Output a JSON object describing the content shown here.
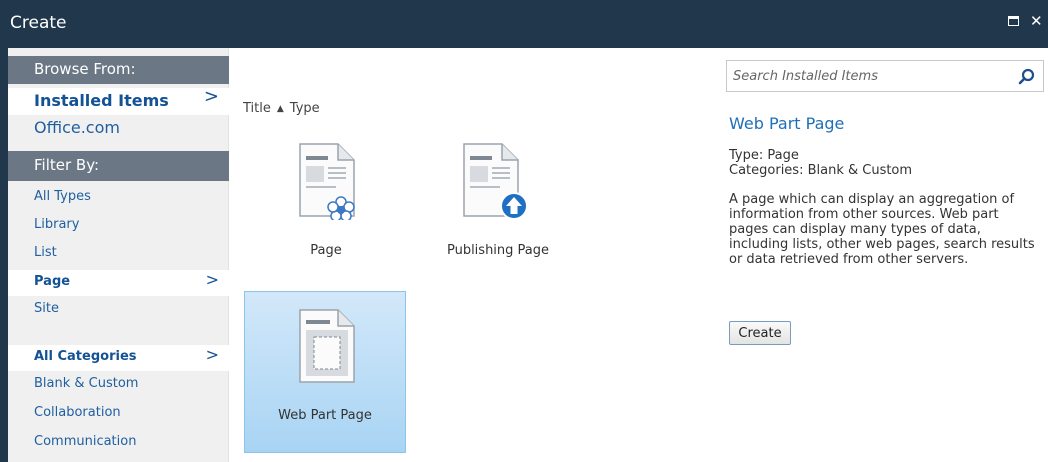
{
  "window": {
    "title": "Create"
  },
  "sidebar": {
    "browse_header": "Browse From:",
    "browse_items": [
      {
        "label": "Installed Items",
        "selected": true,
        "chevron": ">"
      },
      {
        "label": "Office.com",
        "selected": false
      }
    ],
    "filter_header": "Filter By:",
    "type_items": [
      {
        "label": "All Types",
        "selected": false
      },
      {
        "label": "Library",
        "selected": false
      },
      {
        "label": "List",
        "selected": false
      },
      {
        "label": "Page",
        "selected": true,
        "chevron": ">"
      },
      {
        "label": "Site",
        "selected": false
      }
    ],
    "category_items": [
      {
        "label": "All Categories",
        "selected": true,
        "chevron": ">"
      },
      {
        "label": "Blank & Custom",
        "selected": false
      },
      {
        "label": "Collaboration",
        "selected": false
      },
      {
        "label": "Communication",
        "selected": false
      }
    ]
  },
  "sort": {
    "title_label": "Title",
    "title_arrow": "▲",
    "type_label": "Type"
  },
  "items": [
    {
      "label": "Page",
      "icon": "page-flower-icon",
      "selected": false
    },
    {
      "label": "Publishing Page",
      "icon": "publishing-page-icon",
      "selected": false
    },
    {
      "label": "Web Part Page",
      "icon": "web-part-page-icon",
      "selected": true
    }
  ],
  "search": {
    "placeholder": "Search Installed Items",
    "value": ""
  },
  "details": {
    "title": "Web Part Page",
    "type_line": "Type: Page",
    "categories_line": "Categories: Blank & Custom",
    "description": " A page which can display an aggregation of information from other sources. Web part pages can display many types of data, including lists, other web pages, search results or data retrieved from other servers.",
    "create_label": "Create"
  },
  "colors": {
    "titlebar": "#21374c",
    "sidebar_header": "#6b7785",
    "link": "#1f5fa0",
    "detail_title": "#1f6fb8",
    "selected_tile": "#a8d4f4"
  }
}
